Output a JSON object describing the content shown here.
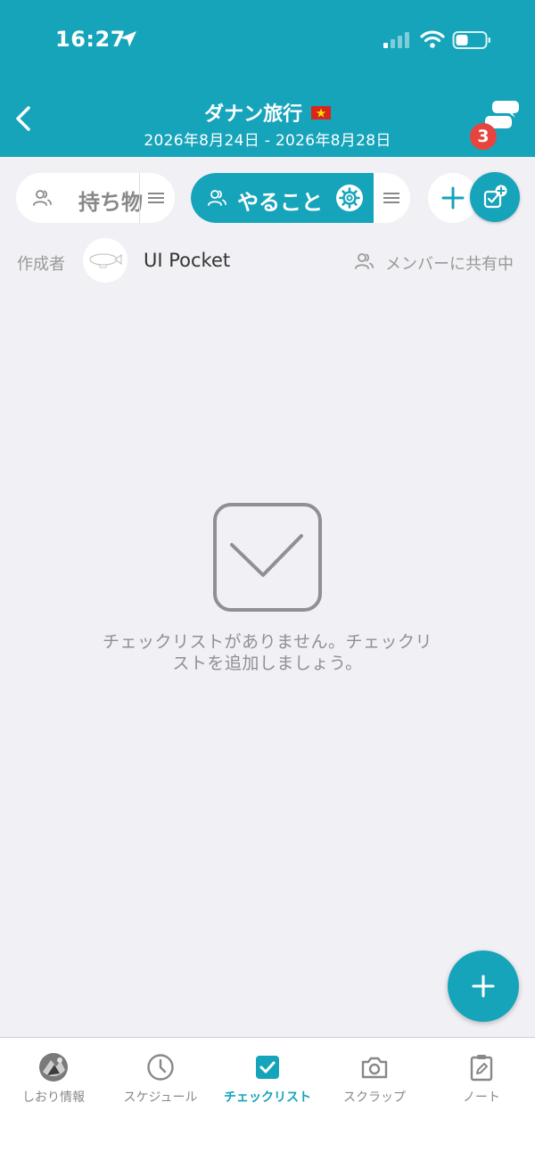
{
  "status_bar": {
    "time": "16:27"
  },
  "header": {
    "title": "ダナン旅行",
    "dates": "2026年8月24日 - 2026年8月28日",
    "chat_badge": "3"
  },
  "tabs": [
    {
      "label": "持ち物",
      "active": false
    },
    {
      "label": "やること",
      "active": true
    }
  ],
  "author": {
    "label": "作成者",
    "name": "UI Pocket"
  },
  "share_status": "メンバーに共有中",
  "empty_state": {
    "message": "チェックリストがありません。チェックリストを追加しましょう。"
  },
  "bottom_nav": [
    {
      "label": "しおり情報",
      "icon": "avatar-icon"
    },
    {
      "label": "スケジュール",
      "icon": "clock-icon"
    },
    {
      "label": "チェックリスト",
      "icon": "checkbox-icon",
      "active": true
    },
    {
      "label": "スクラップ",
      "icon": "camera-icon"
    },
    {
      "label": "ノート",
      "icon": "note-edit-icon"
    }
  ],
  "colors": {
    "accent": "#16a4ba",
    "badge": "#e8443d",
    "background": "#f1f1f5"
  }
}
